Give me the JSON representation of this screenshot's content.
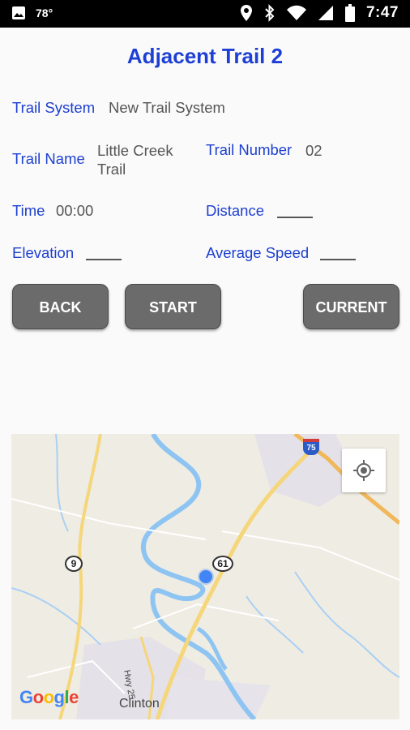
{
  "status_bar": {
    "temperature": "78°",
    "time": "7:47",
    "icons": [
      "image-icon",
      "location-icon",
      "bluetooth-icon",
      "wifi-icon",
      "signal-icon",
      "battery-icon"
    ]
  },
  "page": {
    "title": "Adjacent Trail 2"
  },
  "fields": {
    "trail_system_label": "Trail System",
    "trail_system_value": "New Trail System",
    "trail_name_label": "Trail Name",
    "trail_name_value_line1": "Little Creek",
    "trail_name_value_line2": "Trail",
    "trail_number_label": "Trail Number",
    "trail_number_value": "02",
    "time_label": "Time",
    "time_value": "00:00",
    "distance_label": "Distance",
    "elevation_label": "Elevation",
    "average_speed_label": "Average Speed"
  },
  "buttons": {
    "back": "BACK",
    "start": "START",
    "current": "CURRENT"
  },
  "map": {
    "route_shields": [
      "9",
      "61",
      "75"
    ],
    "road_label": "Hwy 25",
    "place_label": "Clinton",
    "attribution": [
      "G",
      "o",
      "o",
      "g",
      "l",
      "e"
    ]
  },
  "colors": {
    "title": "#1e3fd6",
    "label": "#1e40d0",
    "button_bg": "#6b6b6b",
    "location_dot": "#4285f4"
  }
}
